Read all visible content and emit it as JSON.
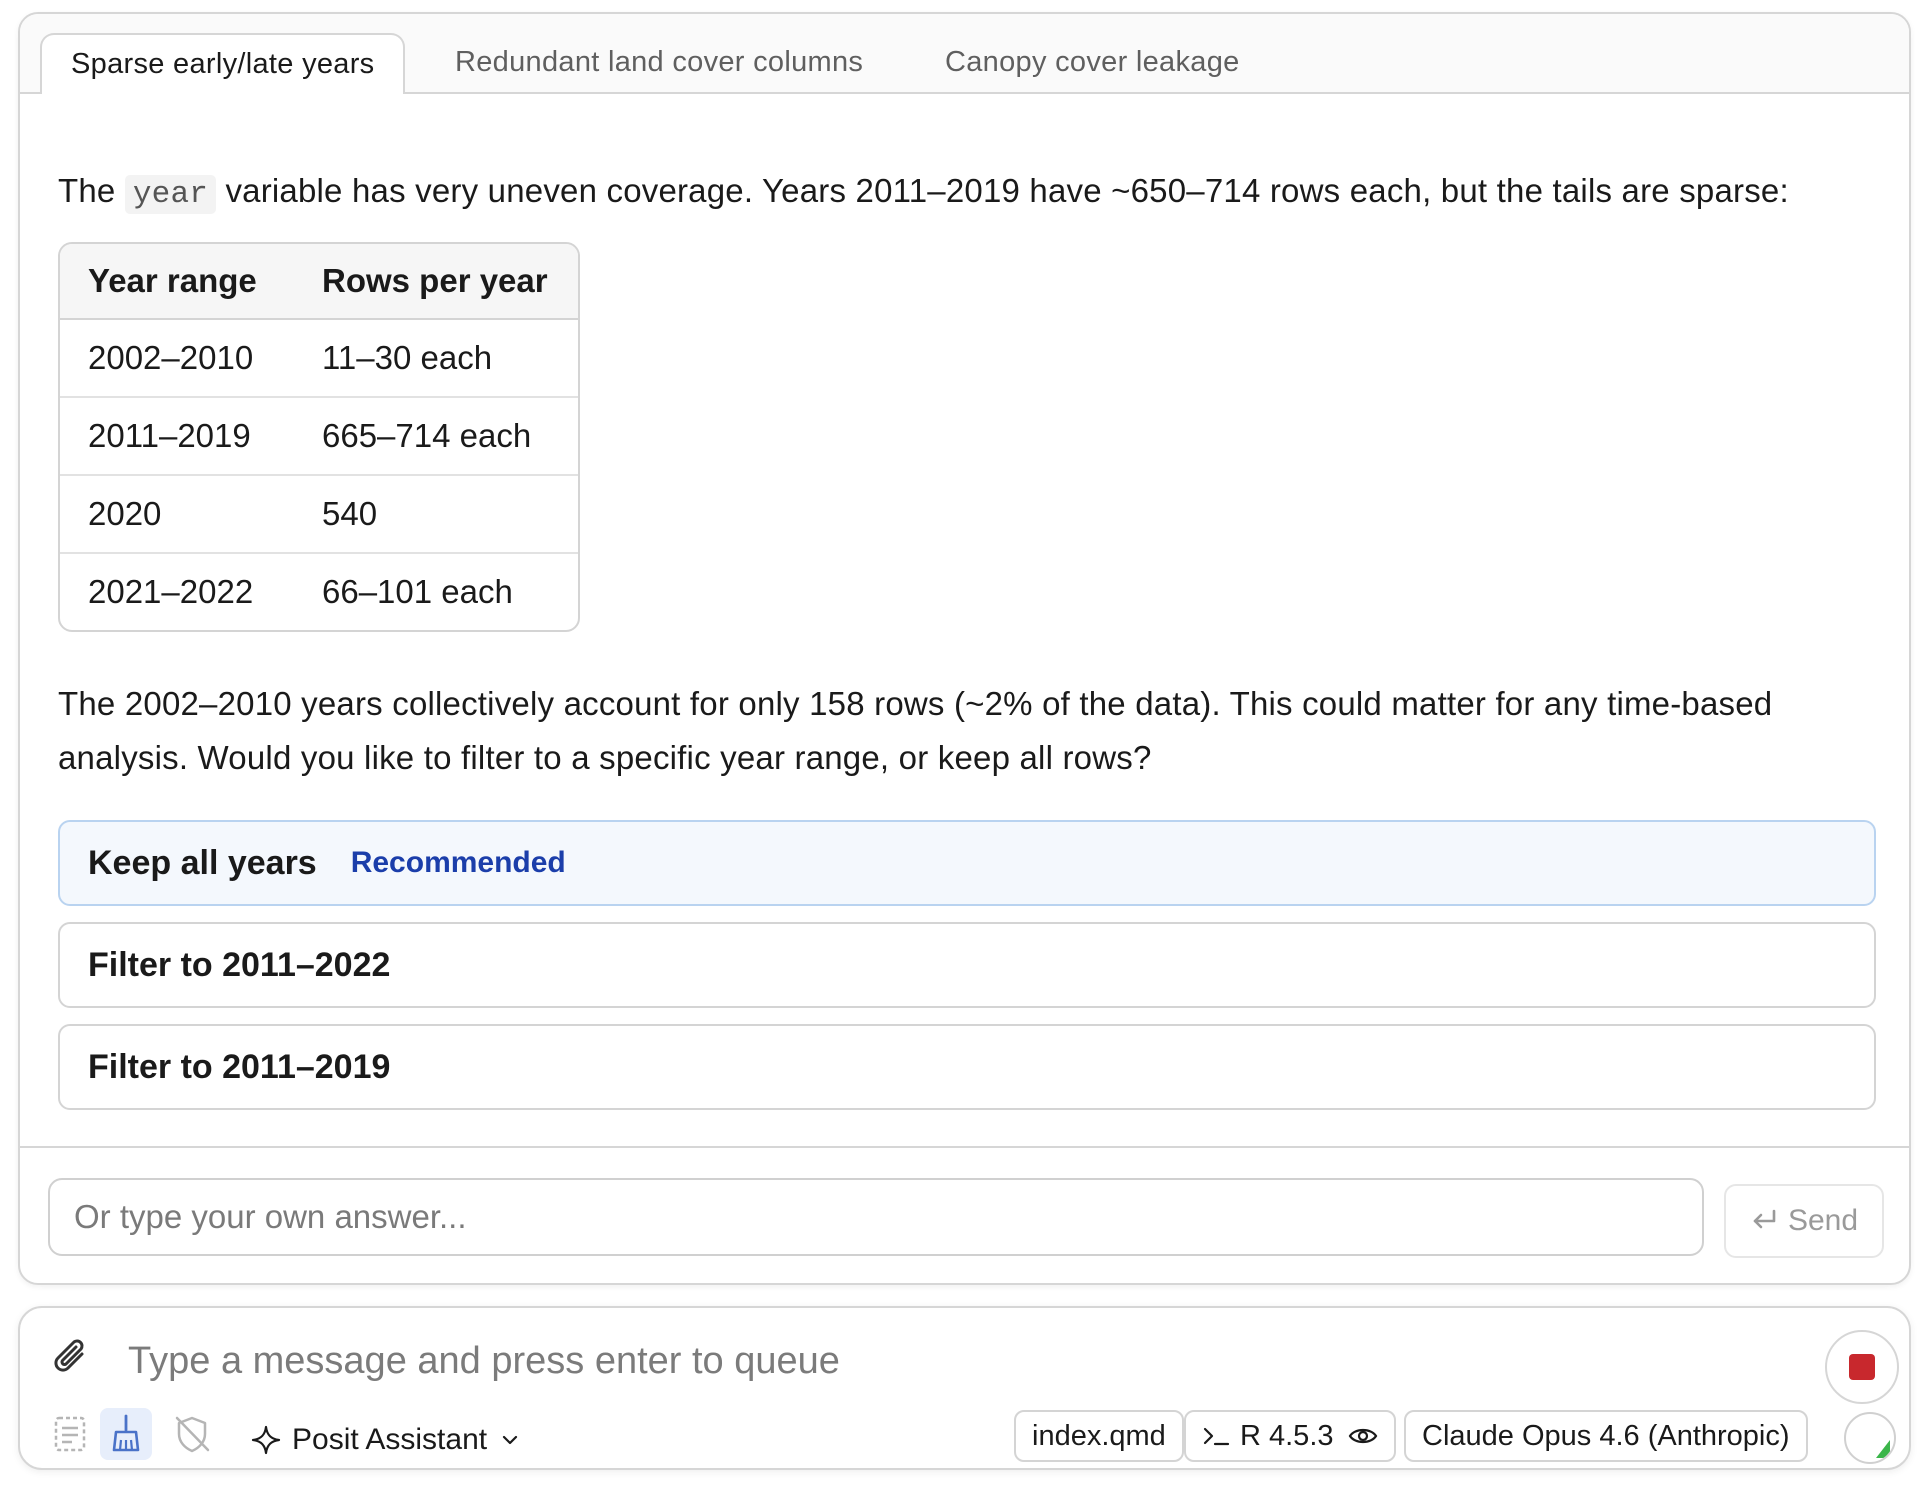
{
  "tabs": [
    {
      "label": "Sparse early/late years"
    },
    {
      "label": "Redundant land cover columns"
    },
    {
      "label": "Canopy cover leakage"
    }
  ],
  "question": {
    "intro_before": "The",
    "code_term": "year",
    "intro_after": "variable has very uneven coverage. Years 2011–2019 have ~650–714 rows each, but the tails are sparse:",
    "table": {
      "headers": [
        "Year range",
        "Rows per year"
      ],
      "rows": [
        [
          "2002–2010",
          "11–30 each"
        ],
        [
          "2011–2019",
          "665–714 each"
        ],
        [
          "2020",
          "540"
        ],
        [
          "2021–2022",
          "66–101 each"
        ]
      ]
    },
    "followup": "The 2002–2010 years collectively account for only 158 rows (~2% of the data). This could matter for any time-based analysis. Would you like to filter to a specific year range, or keep all rows?",
    "options": [
      {
        "label": "Keep all years",
        "badge": "Recommended"
      },
      {
        "label": "Filter to 2011–2022"
      },
      {
        "label": "Filter to 2011–2019"
      }
    ],
    "answer_placeholder": "Or type your own answer...",
    "send_label": "Send"
  },
  "composer": {
    "placeholder": "Type a message and press enter to queue",
    "assistant_label": "Posit Assistant",
    "context_file": "index.qmd",
    "runtime": "R 4.5.3",
    "model": "Claude Opus 4.6 (Anthropic)"
  },
  "colors": {
    "recommended_badge": "#1b3eaa",
    "stop": "#c8282d",
    "progress": "#3bb54a"
  },
  "icons": [
    "paperclip-icon",
    "stop-icon",
    "checklist-icon",
    "broom-icon",
    "shield-off-icon",
    "sparkle-icon",
    "chevron-down-icon",
    "terminal-icon",
    "eye-icon",
    "enter-icon"
  ]
}
